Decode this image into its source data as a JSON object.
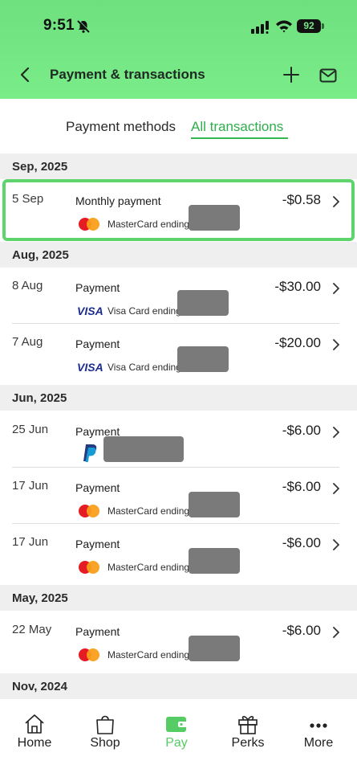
{
  "status_bar": {
    "time": "9:51",
    "battery": "92"
  },
  "header": {
    "title": "Payment & transactions"
  },
  "tabs": {
    "methods": "Payment methods",
    "all": "All transactions"
  },
  "sections": [
    {
      "label": "Sep, 2025",
      "rows": [
        {
          "date": "5 Sep",
          "title": "Monthly payment",
          "amount": "-$0.58",
          "card": "mastercard",
          "card_text": "MasterCard ending"
        }
      ]
    },
    {
      "label": "Aug, 2025",
      "rows": [
        {
          "date": "8 Aug",
          "title": "Payment",
          "amount": "-$30.00",
          "card": "visa",
          "card_text": "Visa Card ending"
        },
        {
          "date": "7 Aug",
          "title": "Payment",
          "amount": "-$20.00",
          "card": "visa",
          "card_text": "Visa Card ending"
        }
      ]
    },
    {
      "label": "Jun, 2025",
      "rows": [
        {
          "date": "25 Jun",
          "title": "Payment",
          "amount": "-$6.00",
          "card": "paypal",
          "card_text": ""
        },
        {
          "date": "17 Jun",
          "title": "Payment",
          "amount": "-$6.00",
          "card": "mastercard",
          "card_text": "MasterCard ending"
        },
        {
          "date": "17 Jun",
          "title": "Payment",
          "amount": "-$6.00",
          "card": "mastercard",
          "card_text": "MasterCard ending"
        }
      ]
    },
    {
      "label": "May, 2025",
      "rows": [
        {
          "date": "22 May",
          "title": "Payment",
          "amount": "-$6.00",
          "card": "mastercard",
          "card_text": "MasterCard ending"
        }
      ]
    },
    {
      "label": "Nov, 2024",
      "rows": []
    }
  ],
  "bottom_nav": {
    "home": "Home",
    "shop": "Shop",
    "pay": "Pay",
    "perks": "Perks",
    "more": "More"
  },
  "colors": {
    "accent": "#34b84f",
    "header": "#72e481",
    "pay_active": "#55cc64"
  },
  "icons": [
    "bell-mute-icon",
    "signal-icon",
    "wifi-icon",
    "battery-icon",
    "back-icon",
    "plus-icon",
    "mail-icon",
    "chevron-right-icon",
    "mastercard-icon",
    "visa-icon",
    "paypal-icon",
    "home-icon",
    "shop-bag-icon",
    "wallet-icon",
    "gift-icon",
    "more-dots-icon"
  ]
}
